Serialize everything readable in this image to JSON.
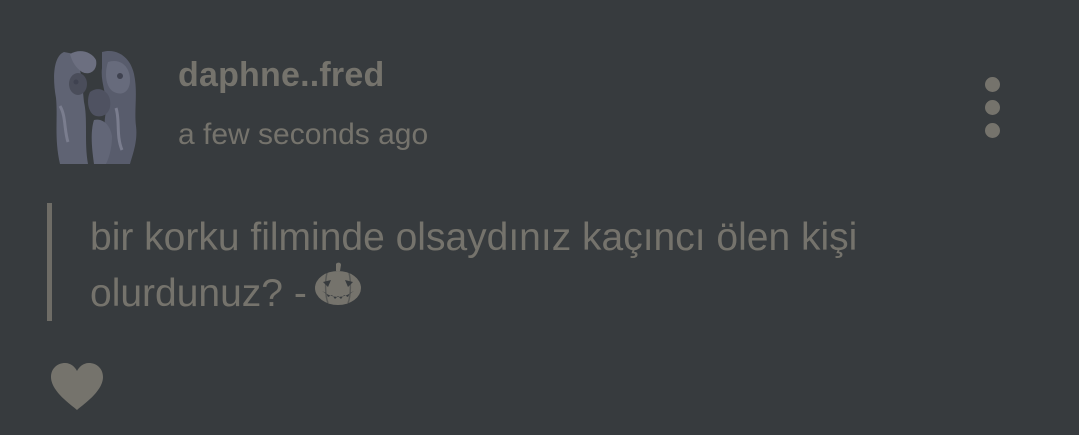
{
  "post": {
    "username": "daphne..fred",
    "timestamp": "a few seconds ago",
    "text_line1": "bir korku filminde olsaydınız kaçıncı ölen kişi",
    "text_line2": "olurdunuz? -",
    "emoji": "jack-o-lantern"
  },
  "icons": {
    "menu": "more-vertical-icon",
    "like": "heart-icon"
  },
  "colors": {
    "background": "#373b3e",
    "text": "#75736c",
    "quote_bar": "#6e6c66"
  }
}
